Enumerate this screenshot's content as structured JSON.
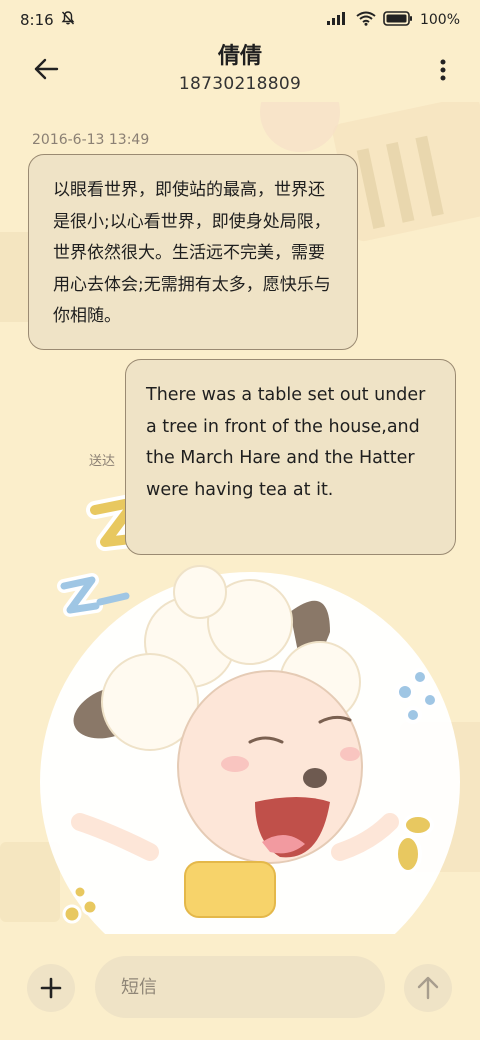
{
  "status_bar": {
    "time": "8:16",
    "battery": "100%",
    "icons": [
      "notifications-muted-icon",
      "signal-icon",
      "wifi-icon",
      "battery-icon"
    ]
  },
  "header": {
    "contact_name": "倩倩",
    "contact_number": "18730218809",
    "back_icon": "back-arrow-icon",
    "more_icon": "more-vert-icon"
  },
  "conversation": {
    "timestamp": "2016-6-13 13:49",
    "messages": [
      {
        "direction": "incoming",
        "text": "以眼看世界，即使站的最高，世界还是很小;以心看世界，即使身处局限，世界依然很大。生活远不完美，需要用心去体会;无需拥有太多，愿快乐与你相随。"
      },
      {
        "direction": "outgoing",
        "text": "There was a table set out under a tree in front of the house,and the March Hare and the Hatter were having tea at it.",
        "status": "送达"
      }
    ]
  },
  "input_bar": {
    "placeholder": "短信",
    "add_icon": "plus-icon",
    "send_icon": "send-arrow-up-icon"
  },
  "colors": {
    "background": "#fbeecb",
    "bubble": "#efe3c6",
    "bubble_border": "#9a8a72"
  }
}
